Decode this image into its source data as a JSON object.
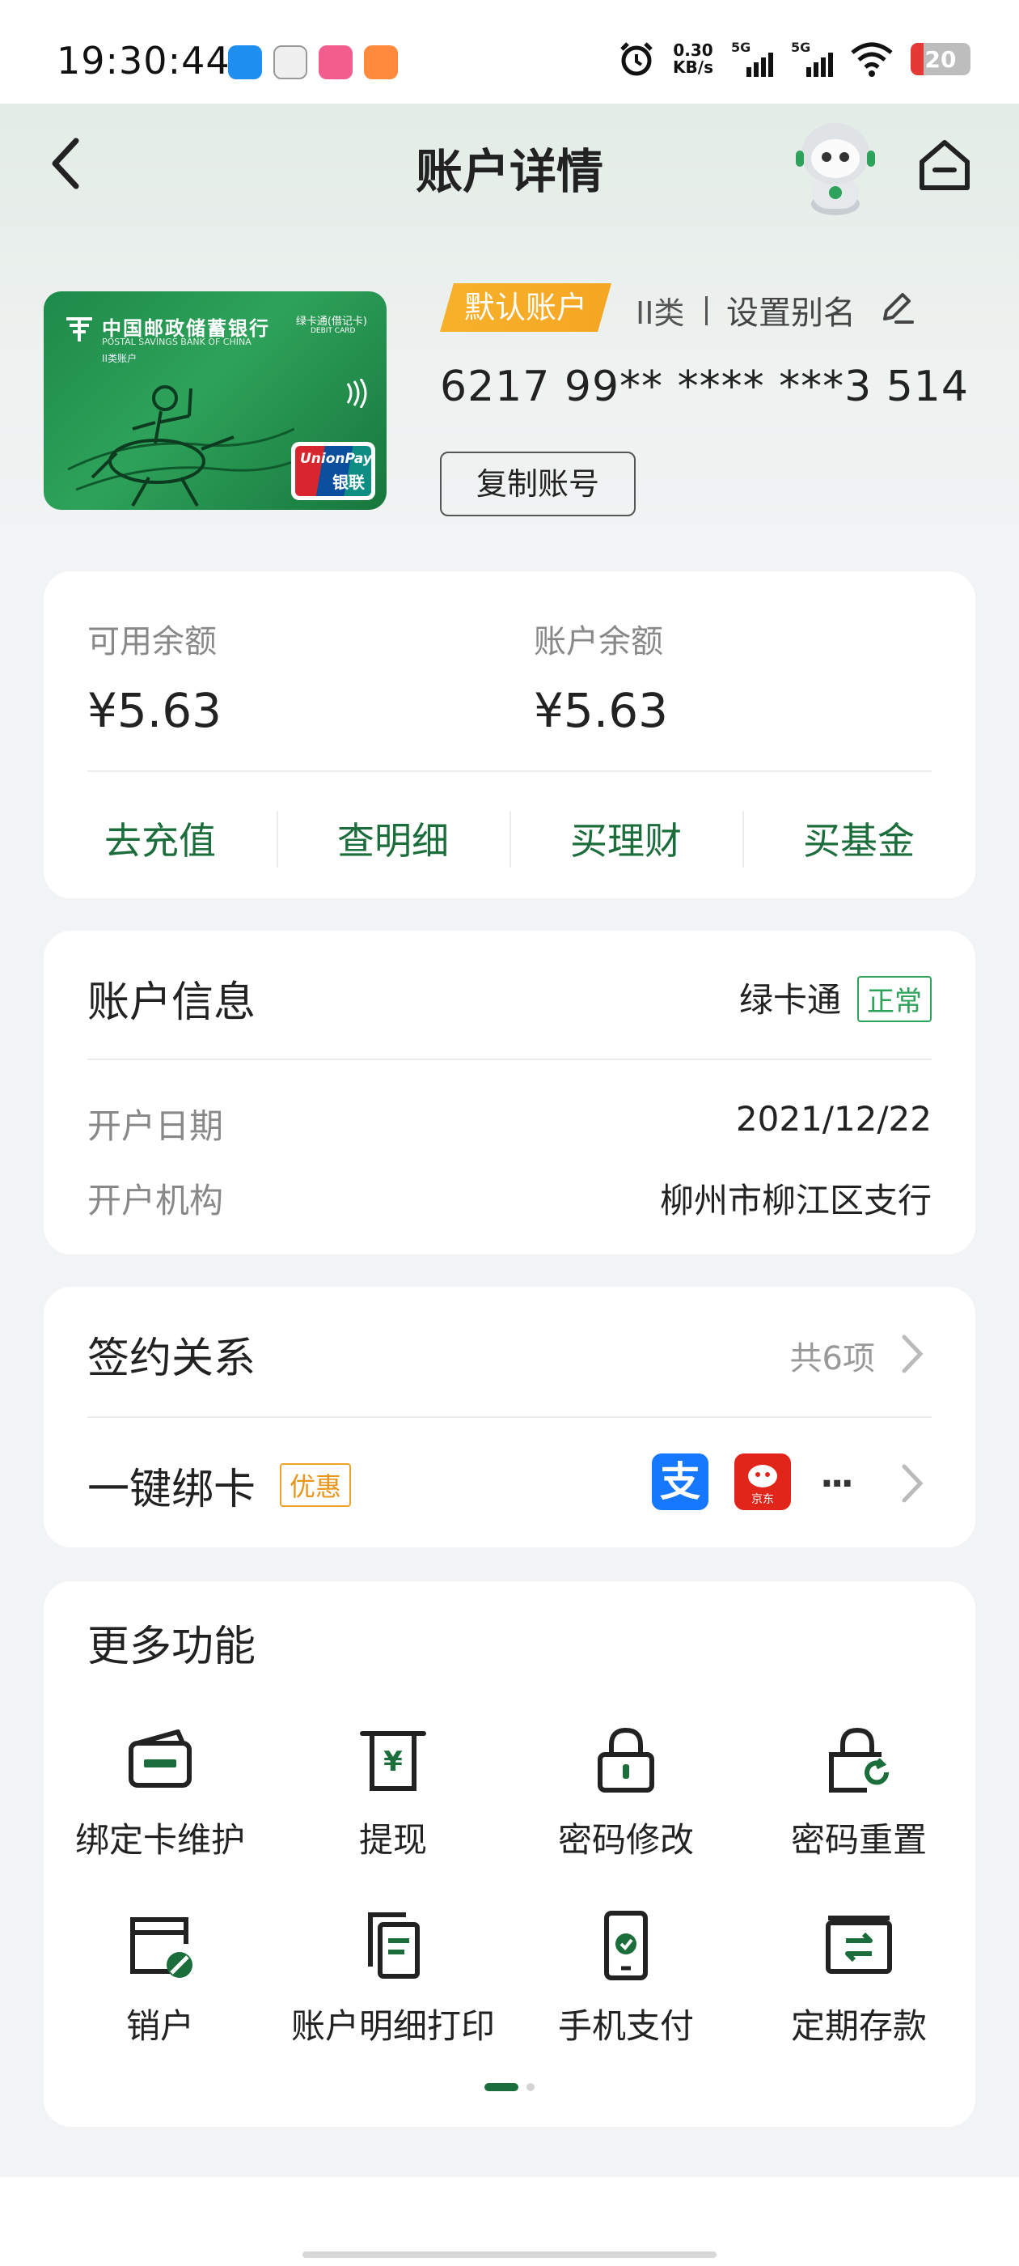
{
  "status_bar": {
    "time": "19:30:44",
    "net_speed_value": "0.30",
    "net_speed_unit": "KB/s",
    "signal1": "5G",
    "signal2": "5G",
    "battery": "20"
  },
  "header": {
    "title": "账户详情"
  },
  "card": {
    "bank_name": "中国邮政储蓄银行",
    "bank_name_en": "POSTAL SAVINGS BANK OF CHINA",
    "account_class_on_card": "II类账户",
    "card_type": "绿卡通(借记卡)",
    "debit_label": "DEBIT CARD",
    "unionpay_en": "UnionPay",
    "unionpay_cn": "银联"
  },
  "account": {
    "default_badge": "默认账户",
    "class_label": "II类",
    "alias_link": "设置别名",
    "number": "6217 99** **** ***3 514",
    "copy_button": "复制账号"
  },
  "balance": {
    "available_label": "可用余额",
    "available_value": "¥5.63",
    "account_label": "账户余额",
    "account_value": "¥5.63",
    "actions": [
      "去充值",
      "查明细",
      "买理财",
      "买基金"
    ]
  },
  "account_info": {
    "title": "账户信息",
    "card_product": "绿卡通",
    "status": "正常",
    "open_date_label": "开户日期",
    "open_date_value": "2021/12/22",
    "branch_label": "开户机构",
    "branch_value": "柳州市柳江区支行"
  },
  "sign": {
    "title": "签约关系",
    "count": "共6项",
    "bind_title": "一键绑卡",
    "promo_badge": "优惠",
    "alipay_glyph": "支",
    "jd_label": "京东",
    "more": "···"
  },
  "more_functions": {
    "title": "更多功能",
    "items": [
      {
        "label": "绑定卡维护",
        "icon": "card-icon"
      },
      {
        "label": "提现",
        "icon": "withdraw-icon"
      },
      {
        "label": "密码修改",
        "icon": "lock-icon"
      },
      {
        "label": "密码重置",
        "icon": "lock-reset-icon"
      },
      {
        "label": "销户",
        "icon": "close-account-icon"
      },
      {
        "label": "账户明细打印",
        "icon": "print-statement-icon"
      },
      {
        "label": "手机支付",
        "icon": "mobile-pay-icon"
      },
      {
        "label": "定期存款",
        "icon": "time-deposit-icon"
      }
    ],
    "pager": {
      "pages": 2,
      "current": 1
    }
  },
  "colors": {
    "accent_green": "#1b6e3b",
    "badge_yellow": "#f5a623",
    "status_green": "#2ea25a"
  }
}
